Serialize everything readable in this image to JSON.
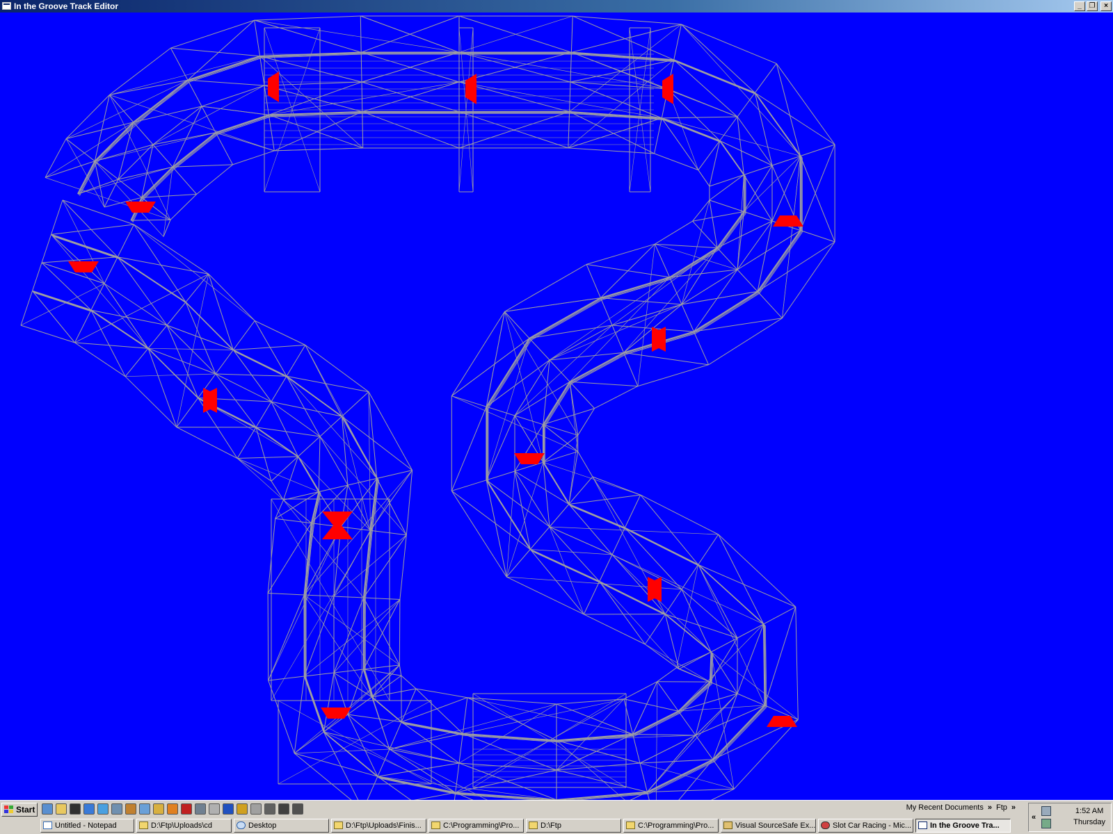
{
  "window": {
    "title": "In the Groove Track Editor",
    "buttons": {
      "minimize": "_",
      "restore": "❐",
      "close": "×"
    }
  },
  "viewport": {
    "background": "#0000ff",
    "wire_color": "#a0a0a0",
    "marker_color": "#ff0000"
  },
  "taskbar": {
    "start_label": "Start",
    "quick_launch": [
      "ie-icon",
      "folder-icon",
      "cmd-icon",
      "ie2-icon",
      "refresh-icon",
      "tools-icon",
      "user-icon",
      "notepad-icon",
      "lightning-icon",
      "vlc-icon",
      "acrobat-icon",
      "link-icon",
      "calc-icon",
      "yahoo-icon",
      "media-icon",
      "save-icon",
      "camera-icon",
      "chip-icon",
      "settings-icon"
    ],
    "recent_docs": "My Recent Documents",
    "ftp": "Ftp",
    "tasks": [
      {
        "label": "Untitled - Notepad",
        "icon": "notepad"
      },
      {
        "label": "D:\\Ftp\\Uploads\\cd",
        "icon": "folder"
      },
      {
        "label": "Desktop",
        "icon": "ie"
      },
      {
        "label": "D:\\Ftp\\Uploads\\Finis...",
        "icon": "folder"
      },
      {
        "label": "C:\\Programming\\Pro...",
        "icon": "folder"
      },
      {
        "label": "D:\\Ftp",
        "icon": "folder"
      },
      {
        "label": "C:\\Programming\\Pro...",
        "icon": "folder"
      },
      {
        "label": "Visual SourceSafe Ex...",
        "icon": "vss"
      },
      {
        "label": "Slot Car Racing - Mic...",
        "icon": "slot"
      },
      {
        "label": "In the Groove Tra...",
        "icon": "app",
        "active": true
      }
    ],
    "clock": {
      "time": "1:52 AM",
      "day": "Thursday"
    }
  }
}
